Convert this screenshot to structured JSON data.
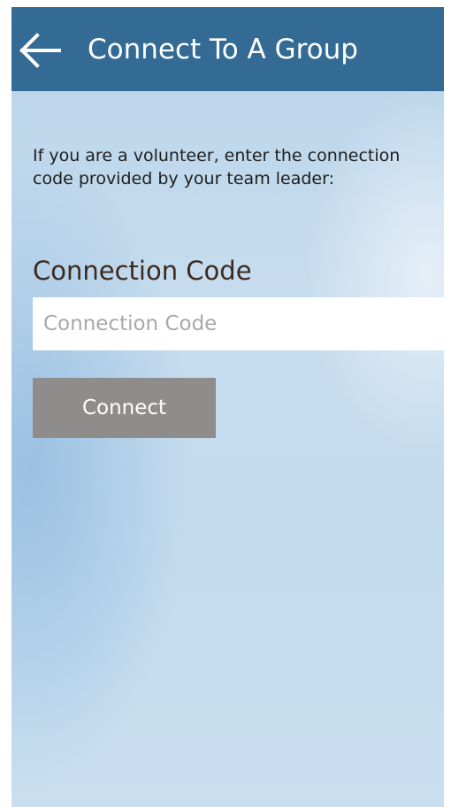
{
  "header": {
    "title": "Connect To A Group",
    "back_icon": "arrow-left-icon",
    "background_color": "#346b95"
  },
  "main": {
    "instructions": "If you are a volunteer, enter the connection code provided by your team leader:",
    "field_label": "Connection Code",
    "code_input": {
      "value": "",
      "placeholder": "Connection Code"
    },
    "connect_button": {
      "label": "Connect",
      "color": "#8e8d8c"
    }
  }
}
